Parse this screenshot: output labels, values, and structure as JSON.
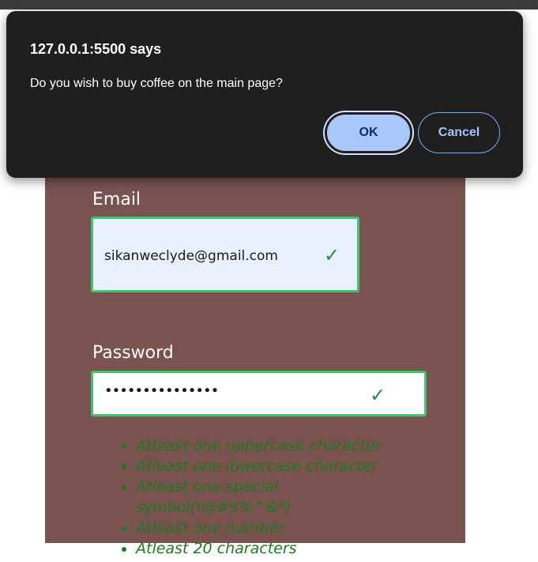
{
  "dialog": {
    "origin": "127.0.0.1:5500 says",
    "message": "Do you wish to buy coffee on the main page?",
    "ok_label": "OK",
    "cancel_label": "Cancel"
  },
  "form": {
    "email_label": "Email",
    "email_value": "sikanweclyde@gmail.com",
    "password_label": "Password",
    "password_value": "•••••••••••••••",
    "valid_mark": "✓",
    "requirements": [
      "Atleast one uppercase character",
      "Atleast one lowercase character",
      "Atleast one special symbol(!@#$%^&*)",
      "Atleast one number",
      "Atleast 20 characters"
    ]
  },
  "colors": {
    "card_background": "#7a5350",
    "valid_border": "#3ec46a",
    "requirement_text": "#1e7a1e",
    "dialog_background": "#1f1f1f",
    "ok_button": "#a8c7fa"
  }
}
